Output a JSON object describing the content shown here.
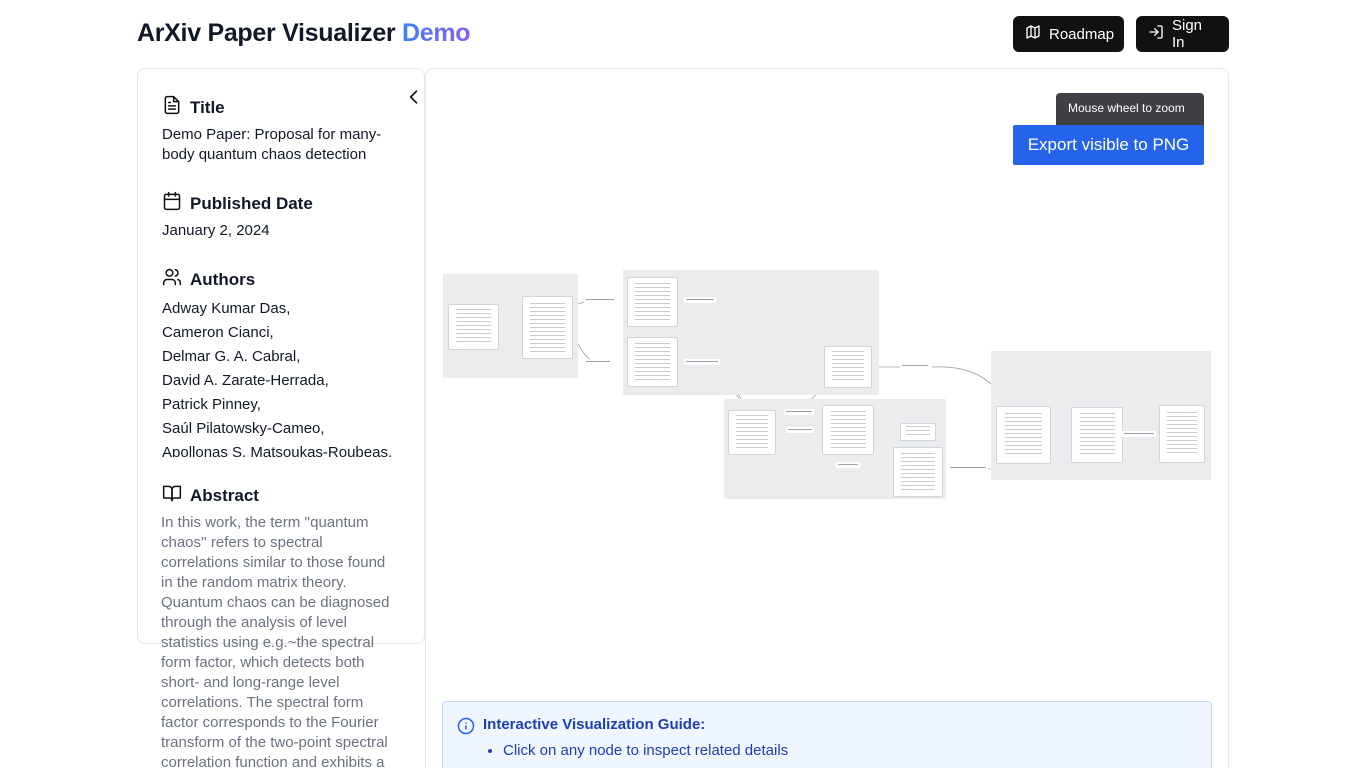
{
  "header": {
    "title_main": "ArXiv Paper Visualizer ",
    "title_accent": "Demo",
    "roadmap_label": "Roadmap",
    "signin_label": "Sign In"
  },
  "sidebar": {
    "title_heading": "Title",
    "title_value": "Demo Paper: Proposal for many-body quantum chaos detection",
    "date_heading": "Published Date",
    "date_value": "January 2, 2024",
    "authors_heading": "Authors",
    "authors": [
      "Adway Kumar Das,",
      "Cameron Cianci,",
      "Delmar G. A. Cabral,",
      "David A. Zarate-Herrada,",
      "Patrick Pinney,",
      "Saúl Pilatowsky-Cameo,",
      "Apollonas S. Matsoukas-Roubeas,"
    ],
    "abstract_heading": "Abstract",
    "abstract_text": "In this work, the term ''quantum chaos'' refers to spectral correlations similar to those found in the random matrix theory. Quantum chaos can be diagnosed through the analysis of level statistics using e.g.~the spectral form factor, which detects both short- and long-range level correlations. The spectral form factor corresponds to the Fourier transform of the two-point spectral correlation function and exhibits a"
  },
  "canvas": {
    "tooltip": "Mouse wheel to zoom",
    "export_label": "Export visible to PNG"
  },
  "guide": {
    "title": "Interactive Visualization Guide:",
    "items": [
      "Click on any node to inspect related details"
    ]
  }
}
